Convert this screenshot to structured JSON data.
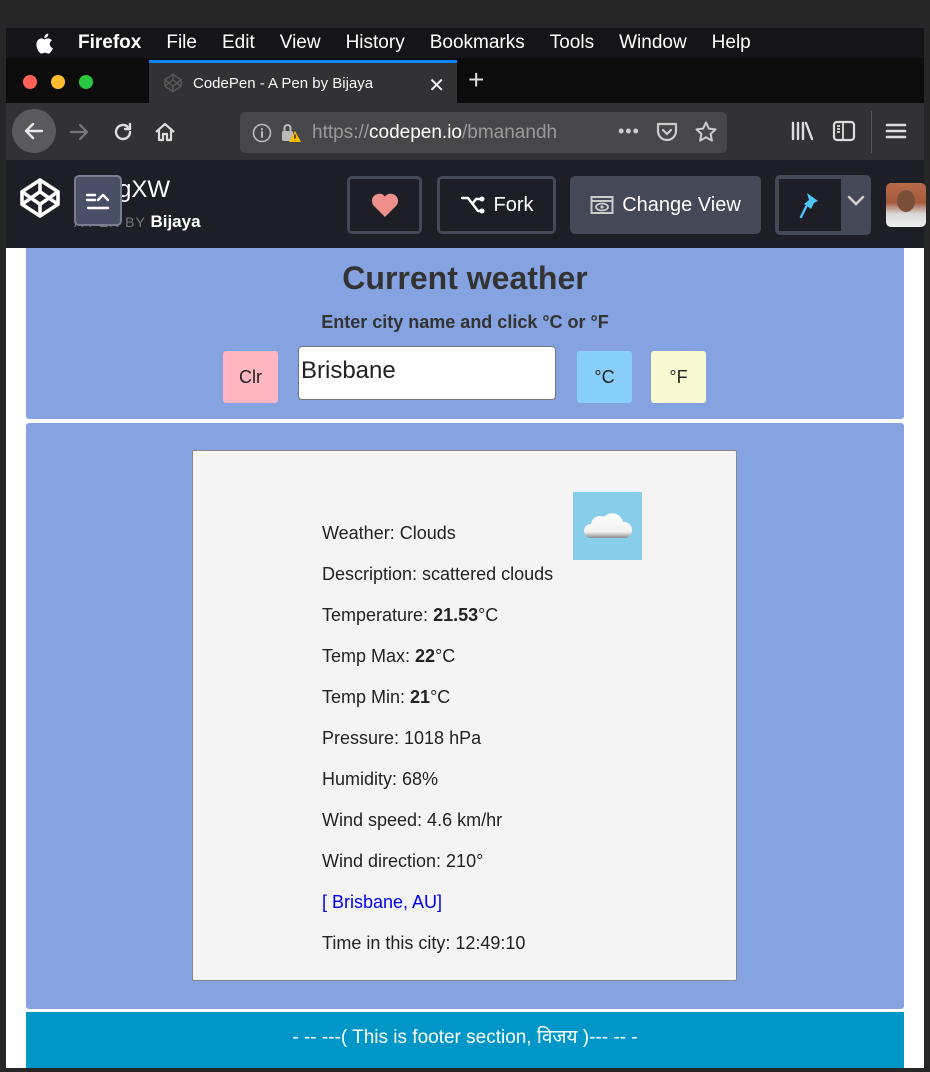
{
  "menubar": {
    "app": "Firefox",
    "items": [
      "File",
      "Edit",
      "View",
      "History",
      "Bookmarks",
      "Tools",
      "Window",
      "Help"
    ]
  },
  "browser": {
    "tab_title": "CodePen - A Pen by Bijaya",
    "url_scheme": "https://",
    "url_host": "codepen.io",
    "url_path": "/bmanandh"
  },
  "codepen": {
    "pen_title_fragment": "gXW",
    "by_label": "A PEN BY",
    "author": "Bijaya",
    "fork_label": "Fork",
    "change_view_label": "Change View"
  },
  "app": {
    "title": "Current weather",
    "instruction": "Enter city name and click °C or °F",
    "clear_label": "Clr",
    "city_value": "Brisbane",
    "celsius_label": "°C",
    "fahrenheit_label": "°F",
    "colors": {
      "panel": "#84a3e0",
      "clear_btn": "#ffb6c1",
      "celsius_btn": "#87cefa",
      "fahrenheit_btn": "#fafad2",
      "footer": "#0096c8"
    }
  },
  "weather": {
    "icon": "cloud-icon",
    "weather_label": "Weather: ",
    "weather_value": "Clouds",
    "description_label": "Description: ",
    "description_value": "scattered clouds",
    "temperature_label": "Temperature: ",
    "temperature_value": "21.53",
    "temperature_unit": "°C",
    "temp_max_label": "Temp Max: ",
    "temp_max_value": "22",
    "temp_max_unit": "°C",
    "temp_min_label": "Temp Min: ",
    "temp_min_value": "21",
    "temp_min_unit": "°C",
    "pressure": "Pressure: 1018 hPa",
    "humidity": "Humidity: 68%",
    "wind_speed": "Wind speed: 4.6 km/hr",
    "wind_direction": "Wind direction: 210°",
    "location_link": "[ Brisbane, AU]",
    "local_time": "Time in this city: 12:49:10"
  },
  "footer": {
    "text": "- -- ---( This is footer section, विजय )--- -- -"
  }
}
